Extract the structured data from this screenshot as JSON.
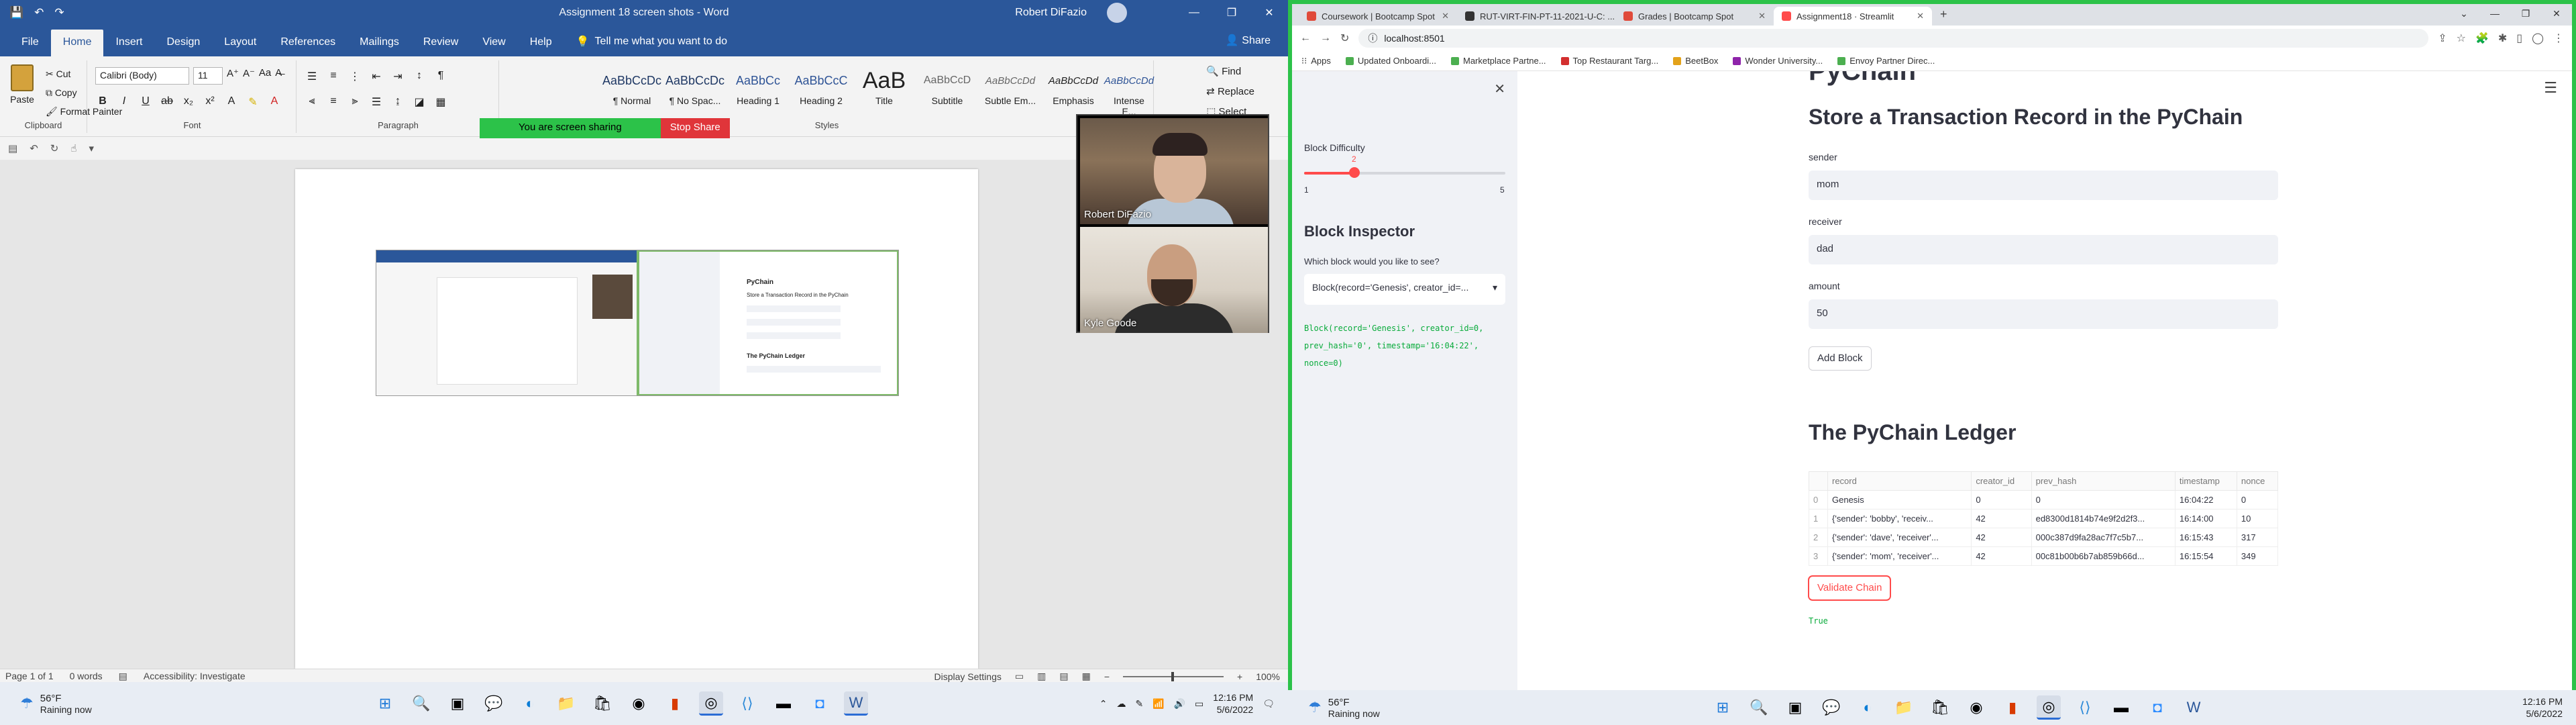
{
  "word": {
    "doc_title": "Assignment 18 screen shots  -  Word",
    "user_name": "Robert DiFazio",
    "window_controls": [
      "—",
      "❐",
      "✕"
    ],
    "tabs": [
      "File",
      "Home",
      "Insert",
      "Design",
      "Layout",
      "References",
      "Mailings",
      "Review",
      "View",
      "Help"
    ],
    "tell_me": "Tell me what you want to do",
    "share": "Share",
    "clipboard": {
      "paste": "Paste",
      "cut": "Cut",
      "copy": "Copy",
      "format_painter": "Format Painter",
      "label": "Clipboard"
    },
    "font": {
      "name": "Calibri (Body)",
      "size": "11",
      "label": "Font"
    },
    "paragraph_label": "Paragraph",
    "styles_label": "Styles",
    "styles": [
      {
        "sample": "AaBbCcDc",
        "name": "¶ Normal"
      },
      {
        "sample": "AaBbCcDc",
        "name": "¶ No Spac..."
      },
      {
        "sample": "AaBbCc",
        "name": "Heading 1"
      },
      {
        "sample": "AaBbCcC",
        "name": "Heading 2"
      },
      {
        "sample": "AaB",
        "name": "Title"
      },
      {
        "sample": "AaBbCcD",
        "name": "Subtitle"
      },
      {
        "sample": "AaBbCcDd",
        "name": "Subtle Em..."
      },
      {
        "sample": "AaBbCcDd",
        "name": "Emphasis"
      },
      {
        "sample": "AaBbCcDd",
        "name": "Intense E..."
      }
    ],
    "editing": {
      "find": "Find",
      "replace": "Replace",
      "select": "Select"
    },
    "sharing": {
      "message": "You are screen sharing",
      "stop": "Stop Share"
    },
    "video": {
      "participant1": "Robert DiFazio",
      "participant2": "Kyle Goode"
    },
    "status": {
      "page": "Page 1 of 1",
      "words": "0 words",
      "accessibility": "Accessibility: Investigate",
      "display_settings": "Display Settings",
      "zoom": "100%"
    },
    "embedded": {
      "title": "PyChain",
      "subtitle": "Store a Transaction Record in the PyChain",
      "ledger_title": "The PyChain Ledger"
    }
  },
  "taskbar_left": {
    "temp": "56°F",
    "weather": "Raining now",
    "time": "12:16 PM",
    "date": "5/6/2022"
  },
  "taskbar_right": {
    "temp": "56°F",
    "weather": "Raining now",
    "time": "12:16 PM",
    "date": "5/6/2022"
  },
  "chrome": {
    "tabs": [
      {
        "title": "Coursework | Bootcamp Spot",
        "active": false
      },
      {
        "title": "RUT-VIRT-FIN-PT-11-2021-U-C: ...",
        "active": false
      },
      {
        "title": "Grades | Bootcamp Spot",
        "active": false
      },
      {
        "title": "Assignment18 · Streamlit",
        "active": true
      }
    ],
    "url": "localhost:8501",
    "bookmarks": [
      "Apps",
      "Updated Onboardi...",
      "Marketplace Partne...",
      "Top Restaurant Targ...",
      "BeetBox",
      "Wonder University...",
      "Envoy Partner Direc..."
    ]
  },
  "streamlit": {
    "sidebar": {
      "block_difficulty_label": "Block Difficulty",
      "slider_value": "2",
      "slider_min": "1",
      "slider_max": "5",
      "slider_fraction": 0.25,
      "inspector_title": "Block Inspector",
      "inspector_prompt": "Which block would you like to see?",
      "selected_block": "Block(record='Genesis', creator_id=...",
      "block_code": "Block(record='Genesis', creator_id=0, prev_hash='0', timestamp='16:04:22', nonce=0)"
    },
    "main": {
      "app_title": "PyChain",
      "store_heading": "Store a Transaction Record in the PyChain",
      "sender_label": "sender",
      "sender_value": "mom",
      "receiver_label": "receiver",
      "receiver_value": "dad",
      "amount_label": "amount",
      "amount_value": "50",
      "add_block_button": "Add Block",
      "ledger_heading": "The PyChain Ledger",
      "ledger_columns": [
        "",
        "record",
        "creator_id",
        "prev_hash",
        "timestamp",
        "nonce"
      ],
      "ledger_rows": [
        [
          "0",
          "Genesis",
          "0",
          "0",
          "16:04:22",
          "0"
        ],
        [
          "1",
          "{'sender': 'bobby', 'receiv...",
          "42",
          "ed8300d1814b74e9f2d2f3...",
          "16:14:00",
          "10"
        ],
        [
          "2",
          "{'sender': 'dave', 'receiver'...",
          "42",
          "000c387d9fa28ac7f7c5b7...",
          "16:15:43",
          "317"
        ],
        [
          "3",
          "{'sender': 'mom', 'receiver'...",
          "42",
          "00c81b00b6b7ab859b66d...",
          "16:15:54",
          "349"
        ]
      ],
      "validate_button": "Validate Chain",
      "validate_result": "True"
    }
  }
}
